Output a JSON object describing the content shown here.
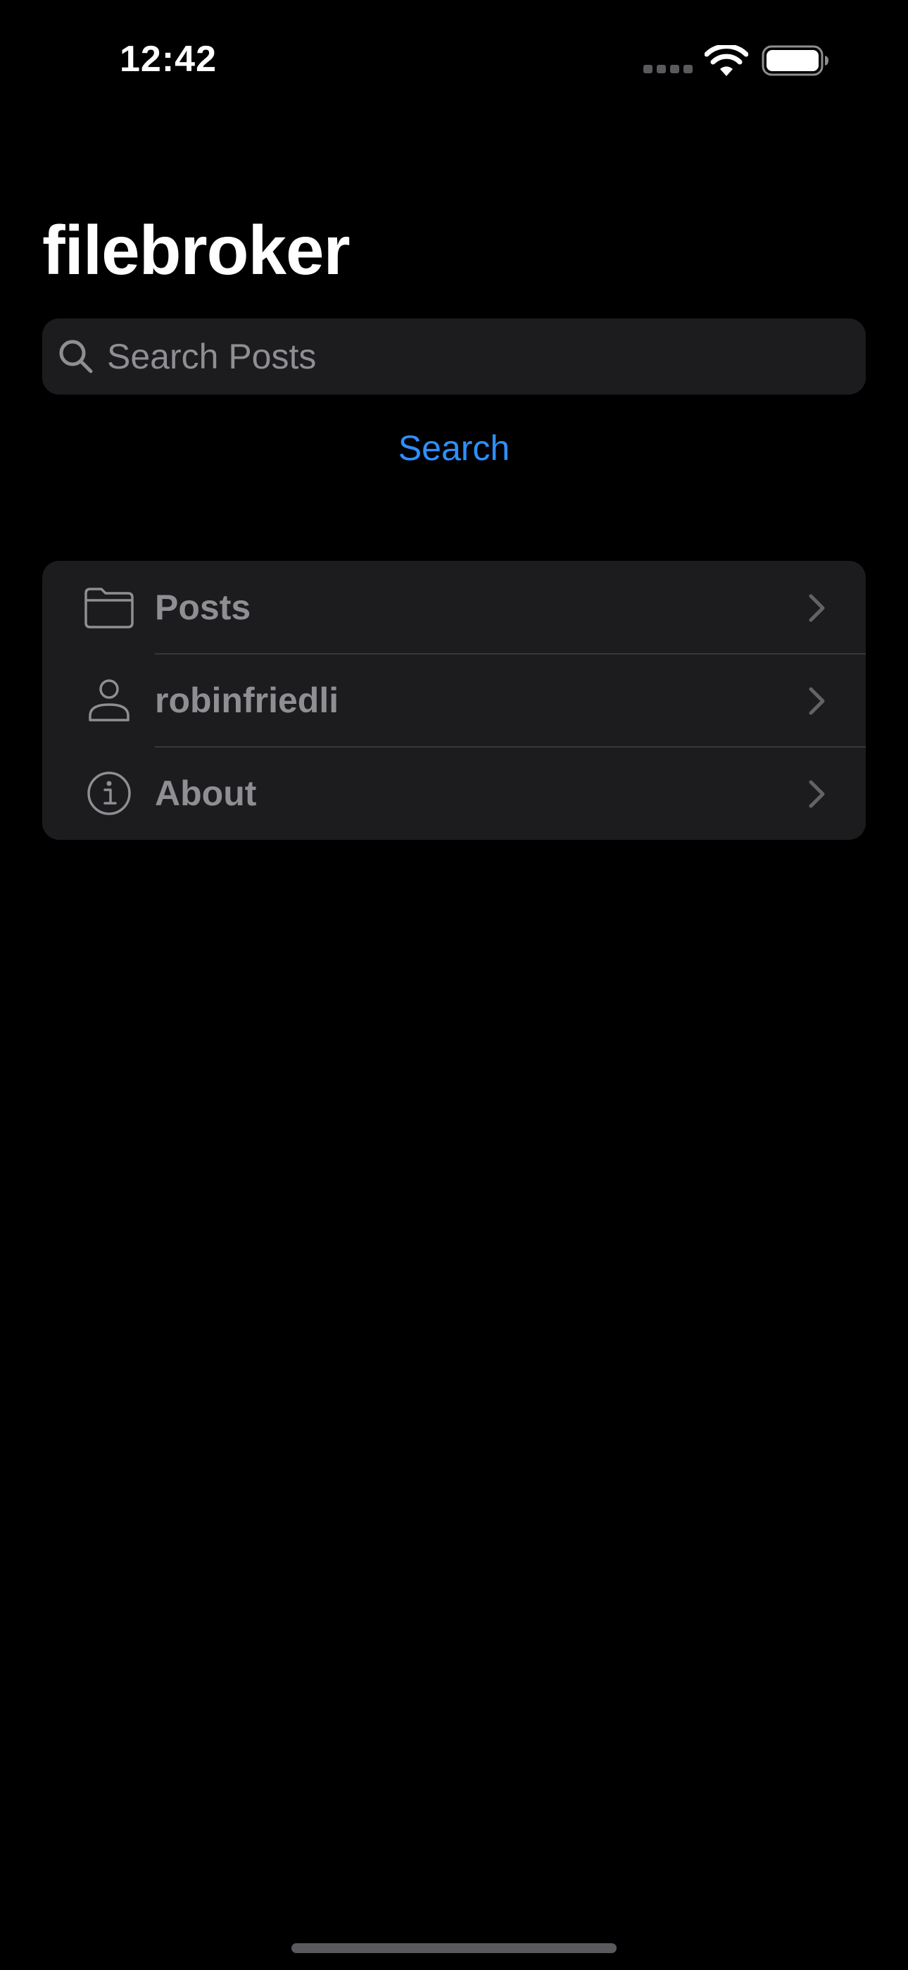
{
  "status_bar": {
    "time": "12:42",
    "signal_icon": "signal-dots-icon",
    "wifi_icon": "wifi-icon",
    "battery_icon": "battery-icon"
  },
  "header": {
    "title": "filebroker"
  },
  "search": {
    "icon": "search-icon",
    "placeholder": "Search Posts",
    "value": "",
    "button_label": "Search"
  },
  "menu": {
    "items": [
      {
        "icon": "folder-icon",
        "label": "Posts"
      },
      {
        "icon": "person-icon",
        "label": "robinfriedli"
      },
      {
        "icon": "info-icon",
        "label": "About"
      }
    ]
  },
  "colors": {
    "background": "#000000",
    "surface": "#1c1c1e",
    "accent": "#2e8fff",
    "secondary_text": "#8e8e93",
    "separator": "#38383a"
  }
}
